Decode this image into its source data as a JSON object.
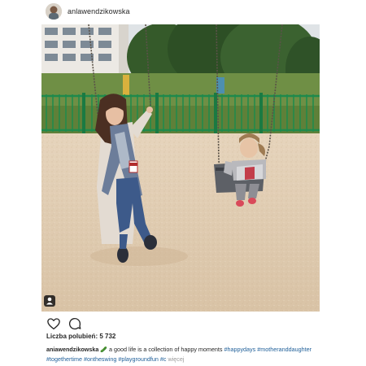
{
  "post": {
    "username": "anlawendzikowska",
    "likes_label": "Liczba polubień:",
    "likes_count": "5 732",
    "caption": {
      "username": "aniawendzikowska",
      "emoji": "🥒",
      "text": " a good life is a collection of happy moments ",
      "hashtags": [
        "#happydays",
        "#motheranddaughter",
        "#togethertime",
        "#ontheswing",
        "#playgroundfun",
        "#c"
      ],
      "more_label": "więcej"
    },
    "icons": {
      "like": "heart-icon",
      "comment": "comment-icon",
      "tagged": "user-tag-icon"
    }
  }
}
